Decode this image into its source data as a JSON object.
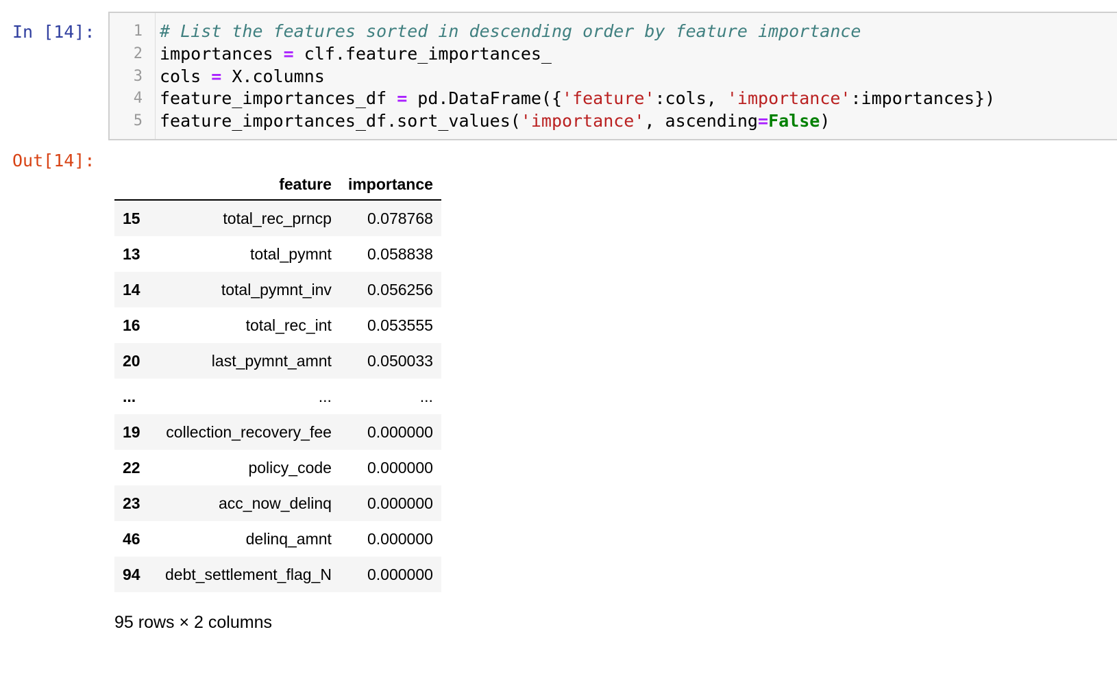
{
  "input_prompt": "In [14]:",
  "output_prompt": "Out[14]:",
  "code": {
    "line_numbers": [
      "1",
      "2",
      "3",
      "4",
      "5"
    ],
    "line1": {
      "comment": "# List the features sorted in descending order by feature importance"
    },
    "line2": {
      "a": "importances ",
      "op": "=",
      "b": " clf.feature_importances_"
    },
    "line3": {
      "a": "cols ",
      "op": "=",
      "b": " X.columns"
    },
    "line4": {
      "a": "feature_importances_df ",
      "op": "=",
      "b": " pd.DataFrame({",
      "s1": "'feature'",
      "c": ":cols, ",
      "s2": "'importance'",
      "d": ":importances})"
    },
    "line5": {
      "a": "feature_importances_df.sort_values(",
      "s1": "'importance'",
      "b": ", ascending",
      "op": "=",
      "kw": "False",
      "c": ")"
    }
  },
  "table": {
    "columns": [
      "",
      "feature",
      "importance"
    ],
    "rows": [
      {
        "index": "15",
        "feature": "total_rec_prncp",
        "importance": "0.078768"
      },
      {
        "index": "13",
        "feature": "total_pymnt",
        "importance": "0.058838"
      },
      {
        "index": "14",
        "feature": "total_pymnt_inv",
        "importance": "0.056256"
      },
      {
        "index": "16",
        "feature": "total_rec_int",
        "importance": "0.053555"
      },
      {
        "index": "20",
        "feature": "last_pymnt_amnt",
        "importance": "0.050033"
      },
      {
        "index": "...",
        "feature": "...",
        "importance": "..."
      },
      {
        "index": "19",
        "feature": "collection_recovery_fee",
        "importance": "0.000000"
      },
      {
        "index": "22",
        "feature": "policy_code",
        "importance": "0.000000"
      },
      {
        "index": "23",
        "feature": "acc_now_delinq",
        "importance": "0.000000"
      },
      {
        "index": "46",
        "feature": "delinq_amnt",
        "importance": "0.000000"
      },
      {
        "index": "94",
        "feature": "debt_settlement_flag_N",
        "importance": "0.000000"
      }
    ]
  },
  "shape_caption": "95 rows × 2 columns"
}
